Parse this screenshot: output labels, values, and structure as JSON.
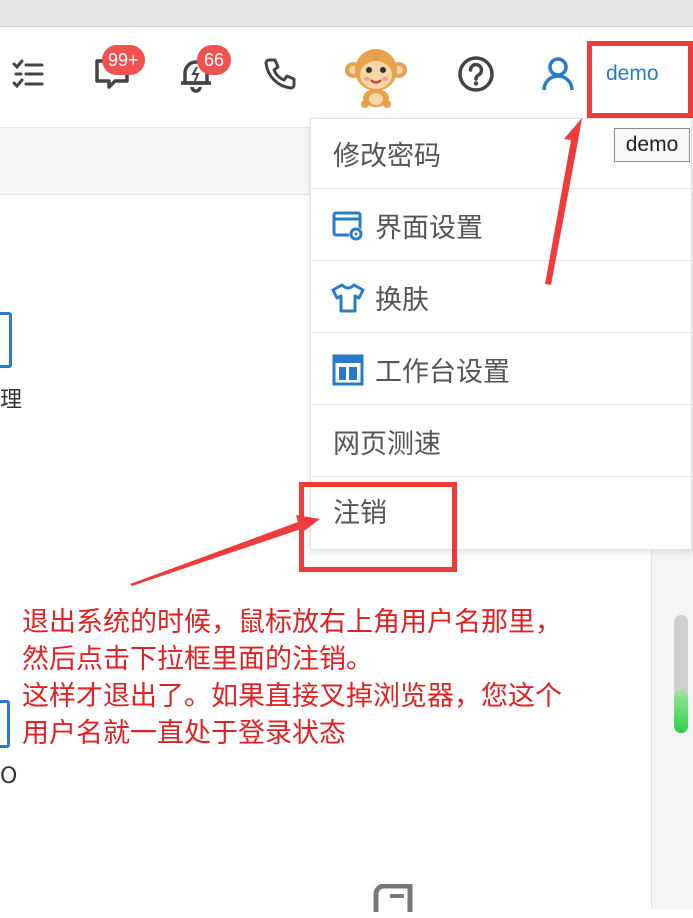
{
  "header": {
    "chat_badge": "99+",
    "notify_badge": "66",
    "username": "demo"
  },
  "tooltip": "demo",
  "dropdown": {
    "items": [
      {
        "label": "修改密码",
        "icon": ""
      },
      {
        "label": "界面设置",
        "icon": "ui-settings-icon"
      },
      {
        "label": "换肤",
        "icon": "tshirt-icon"
      },
      {
        "label": "工作台设置",
        "icon": "layout-icon"
      },
      {
        "label": "网页测速",
        "icon": ""
      },
      {
        "label": "注销",
        "icon": ""
      }
    ]
  },
  "background": {
    "partial_label_1": "理",
    "partial_label_2": "O"
  },
  "annotation": {
    "lines": [
      "退出系统的时候，鼠标放右上角用户名那里，",
      "然后点击下拉框里面的注销。",
      "这样才退出了。如果直接叉掉浏览器，您这个",
      "用户名就一直处于登录状态"
    ]
  },
  "colors": {
    "accent": "#2a7bc6",
    "badge": "#f05252",
    "annotation_red": "#e22222"
  }
}
